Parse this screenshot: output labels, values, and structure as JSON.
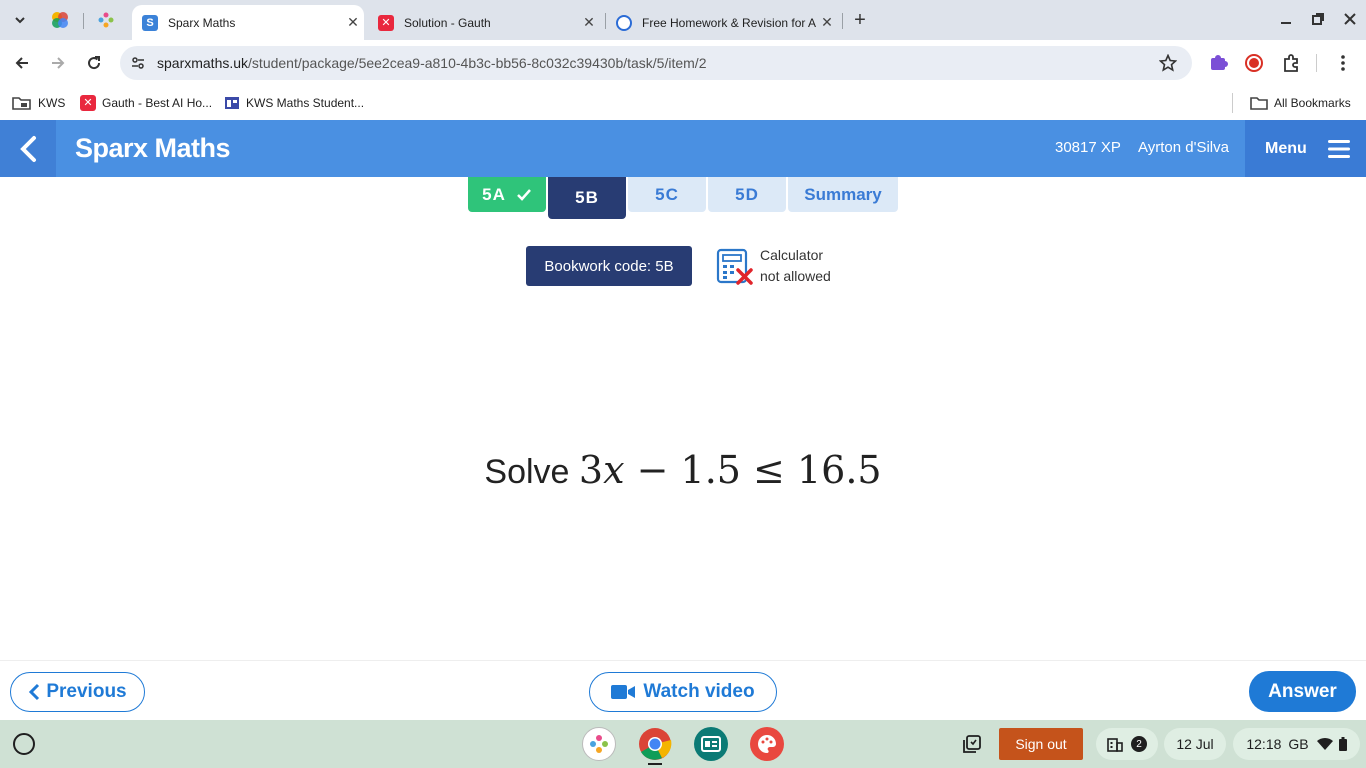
{
  "browser": {
    "tabs": [
      {
        "title": "Sparx Maths",
        "favicon": "S",
        "active": true
      },
      {
        "title": "Solution - Gauth",
        "active": false
      },
      {
        "title": "Free Homework & Revision for A",
        "active": false
      }
    ],
    "url_host": "sparxmaths.uk",
    "url_path": "/student/package/5ee2cea9-a810-4b3c-bb56-8c032c39430b/task/5/item/2",
    "bookmarks": [
      {
        "label": "KWS",
        "icon": "folder-shortcut-icon"
      },
      {
        "label": "Gauth - Best AI Ho...",
        "icon": "gauth-icon"
      },
      {
        "label": "KWS Maths Student...",
        "icon": "classroom-icon"
      }
    ],
    "all_bookmarks_label": "All Bookmarks"
  },
  "sparx": {
    "brand": "Sparx Maths",
    "xp": "30817 XP",
    "user_name": "Ayrton d'Silva",
    "menu_label": "Menu",
    "task_tabs": [
      {
        "label": "5A",
        "state": "complete"
      },
      {
        "label": "5B",
        "state": "active"
      },
      {
        "label": "5C",
        "state": "todo"
      },
      {
        "label": "5D",
        "state": "todo"
      },
      {
        "label": "Summary",
        "state": "todo"
      }
    ],
    "bookwork_code": "Bookwork code: 5B",
    "calculator_line1": "Calculator",
    "calculator_line2": "not allowed",
    "question": {
      "prefix": "Solve",
      "coef": "3",
      "var": "x",
      "minus": " − 1.5 ",
      "leq": "≤",
      "rhs": " 16.5"
    },
    "previous_label": "Previous",
    "watch_video_label": "Watch video",
    "answer_label": "Answer"
  },
  "shelf": {
    "sign_out": "Sign out",
    "notification_count": "2",
    "date": "12 Jul",
    "time": "12:18",
    "locale": "GB"
  },
  "colors": {
    "header_blue": "#4a90e2",
    "complete_green": "#2fc47a",
    "active_navy": "#283c73",
    "tab_light": "#dce9f7",
    "answer_blue": "#1f7ad6",
    "sign_out_orange": "#c5531b"
  }
}
